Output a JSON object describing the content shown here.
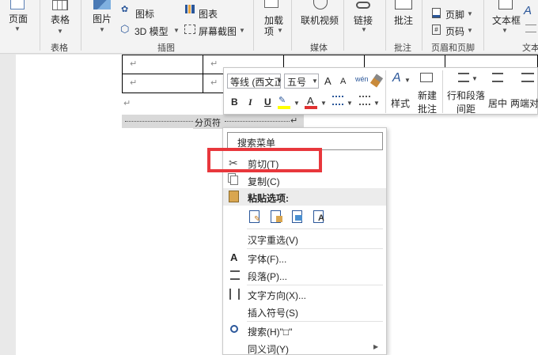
{
  "ribbon": {
    "page_label": "页面",
    "table_label": "表格",
    "table_group": "表格",
    "picture_label": "图片",
    "icons_label": "图标",
    "model3d_label": "3D 模型",
    "chart_label": "图表",
    "screenshot_label": "屏幕截图",
    "illustrations_group": "插图",
    "addins_label1": "加载",
    "addins_label2": "项",
    "online_video_label": "联机视频",
    "media_group": "媒体",
    "link_label": "链接",
    "comment_label": "批注",
    "comment_group": "批注",
    "footer_label": "页脚",
    "page_number_label": "页码",
    "header_footer_group": "页眉和页脚",
    "textbox_label": "文本框",
    "text_group": "文本"
  },
  "document": {
    "para_mark": "↵",
    "page_break_label": "分页符"
  },
  "mini_toolbar": {
    "font_name": "等线 (西文正",
    "font_size": "五号",
    "grow_font": "A",
    "shrink_font": "A",
    "bold": "B",
    "italic": "I",
    "underline": "U",
    "font_color": "A",
    "styles_label": "样式",
    "new_comment_label1": "新建",
    "new_comment_label2": "批注",
    "line_spacing_label1": "行和段落",
    "line_spacing_label2": "间距",
    "center_label": "居中",
    "justify_label": "两端对齐",
    "colors": {
      "highlight": "#ffff00",
      "font_color": "#e03131"
    }
  },
  "context_menu": {
    "search_placeholder": "搜索菜单",
    "cut": "剪切(T)",
    "copy": "复制(C)",
    "paste_options": "粘贴选项:",
    "reconvert": "汉字重选(V)",
    "font": "字体(F)...",
    "paragraph": "段落(P)...",
    "text_direction": "文字方向(X)...",
    "insert_symbol": "插入符号(S)",
    "search": "搜索(H)\"□\"",
    "synonyms": "同义词(Y)"
  },
  "colors": {
    "highlight_border": "#e8373c",
    "accent_blue": "#2b579a"
  }
}
